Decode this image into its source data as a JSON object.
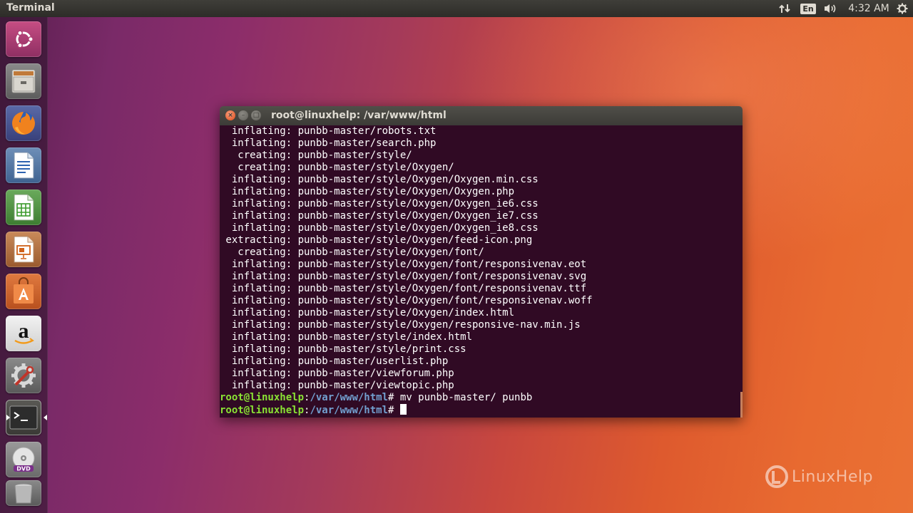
{
  "top_panel": {
    "app_title": "Terminal",
    "keyboard_layout": "En",
    "clock": "4:32 AM"
  },
  "launcher": {
    "items": [
      {
        "name": "ubuntu-dash",
        "icon": "ubuntu-logo-icon"
      },
      {
        "name": "files",
        "icon": "file-cabinet-icon"
      },
      {
        "name": "firefox",
        "icon": "firefox-icon"
      },
      {
        "name": "libreoffice-writer",
        "icon": "writer-document-icon"
      },
      {
        "name": "libreoffice-calc",
        "icon": "calc-spreadsheet-icon"
      },
      {
        "name": "libreoffice-impress",
        "icon": "impress-presentation-icon"
      },
      {
        "name": "ubuntu-software",
        "icon": "software-bag-icon"
      },
      {
        "name": "amazon",
        "icon": "amazon-icon"
      },
      {
        "name": "system-settings",
        "icon": "settings-tools-icon"
      },
      {
        "name": "terminal",
        "icon": "terminal-icon"
      },
      {
        "name": "dvd",
        "icon": "dvd-icon"
      },
      {
        "name": "trash",
        "icon": "trash-icon"
      }
    ]
  },
  "terminal": {
    "title": "root@linuxhelp: /var/www/html",
    "output_lines": [
      "  inflating: punbb-master/robots.txt",
      "  inflating: punbb-master/search.php",
      "   creating: punbb-master/style/",
      "   creating: punbb-master/style/Oxygen/",
      "  inflating: punbb-master/style/Oxygen/Oxygen.min.css",
      "  inflating: punbb-master/style/Oxygen/Oxygen.php",
      "  inflating: punbb-master/style/Oxygen/Oxygen_ie6.css",
      "  inflating: punbb-master/style/Oxygen/Oxygen_ie7.css",
      "  inflating: punbb-master/style/Oxygen/Oxygen_ie8.css",
      " extracting: punbb-master/style/Oxygen/feed-icon.png",
      "   creating: punbb-master/style/Oxygen/font/",
      "  inflating: punbb-master/style/Oxygen/font/responsivenav.eot",
      "  inflating: punbb-master/style/Oxygen/font/responsivenav.svg",
      "  inflating: punbb-master/style/Oxygen/font/responsivenav.ttf",
      "  inflating: punbb-master/style/Oxygen/font/responsivenav.woff",
      "  inflating: punbb-master/style/Oxygen/index.html",
      "  inflating: punbb-master/style/Oxygen/responsive-nav.min.js",
      "  inflating: punbb-master/style/index.html",
      "  inflating: punbb-master/style/print.css",
      "  inflating: punbb-master/userlist.php",
      "  inflating: punbb-master/viewforum.php",
      "  inflating: punbb-master/viewtopic.php"
    ],
    "prompt_user": "root@linuxhelp",
    "prompt_sep": ":",
    "prompt_path": "/var/www/html",
    "prompt_symbol": "# ",
    "command": "mv punbb-master/ punbb"
  },
  "watermark": {
    "text": "LinuxHelp"
  },
  "colors": {
    "terminal_bg": "#300a24",
    "prompt_user": "#8ae234",
    "prompt_path": "#729fcf",
    "panel_bg": "#2d2c28"
  }
}
